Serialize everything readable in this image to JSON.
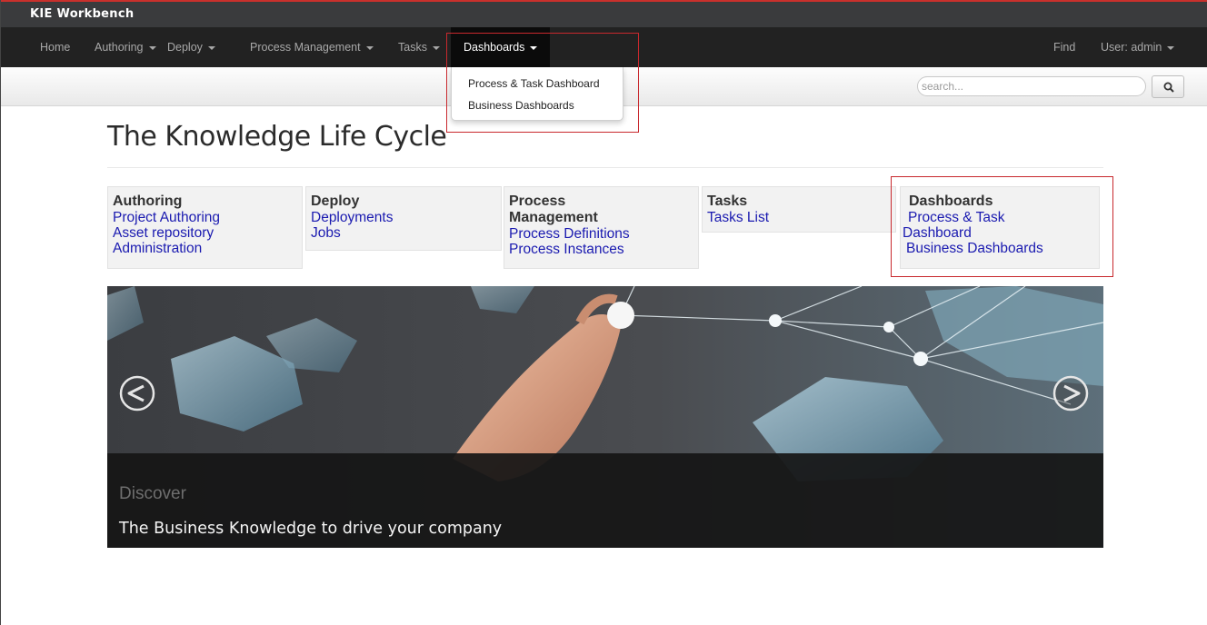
{
  "app": {
    "title": "KIE Workbench"
  },
  "nav": {
    "home": "Home",
    "authoring": "Authoring",
    "deploy": "Deploy",
    "process_management": "Process Management",
    "tasks": "Tasks",
    "dashboards": "Dashboards",
    "find": "Find",
    "user": "User: admin"
  },
  "dropdown": {
    "items": [
      "Process & Task Dashboard",
      "Business Dashboards"
    ]
  },
  "search": {
    "placeholder": "search...",
    "button_icon": "search-icon"
  },
  "page": {
    "title": "The Knowledge Life Cycle"
  },
  "tiles": [
    {
      "title": "Authoring",
      "links": [
        "Project Authoring",
        "Asset repository",
        "Administration"
      ]
    },
    {
      "title": "Deploy",
      "links": [
        "Deployments",
        "Jobs"
      ]
    },
    {
      "title_line1": "Process",
      "title_line2": "Management",
      "links": [
        "Process Definitions",
        "Process Instances"
      ]
    },
    {
      "title": "Tasks",
      "links": [
        "Tasks List"
      ]
    },
    {
      "title": "Dashboards",
      "link1_line1": "Process & Task",
      "link1_line2": "Dashboard",
      "link2": "Business Dashboards"
    }
  ],
  "carousel": {
    "caption_title": "Discover",
    "caption_text": "The Business Knowledge to drive your company",
    "prev_icon": "chevron-left-circle-icon",
    "next_icon": "chevron-right-circle-icon"
  },
  "colors": {
    "navbar_bg": "#222222",
    "titlebar_bg": "#3a3b3d",
    "link": "#1a1ab0",
    "highlight_box": "#c8282d"
  }
}
